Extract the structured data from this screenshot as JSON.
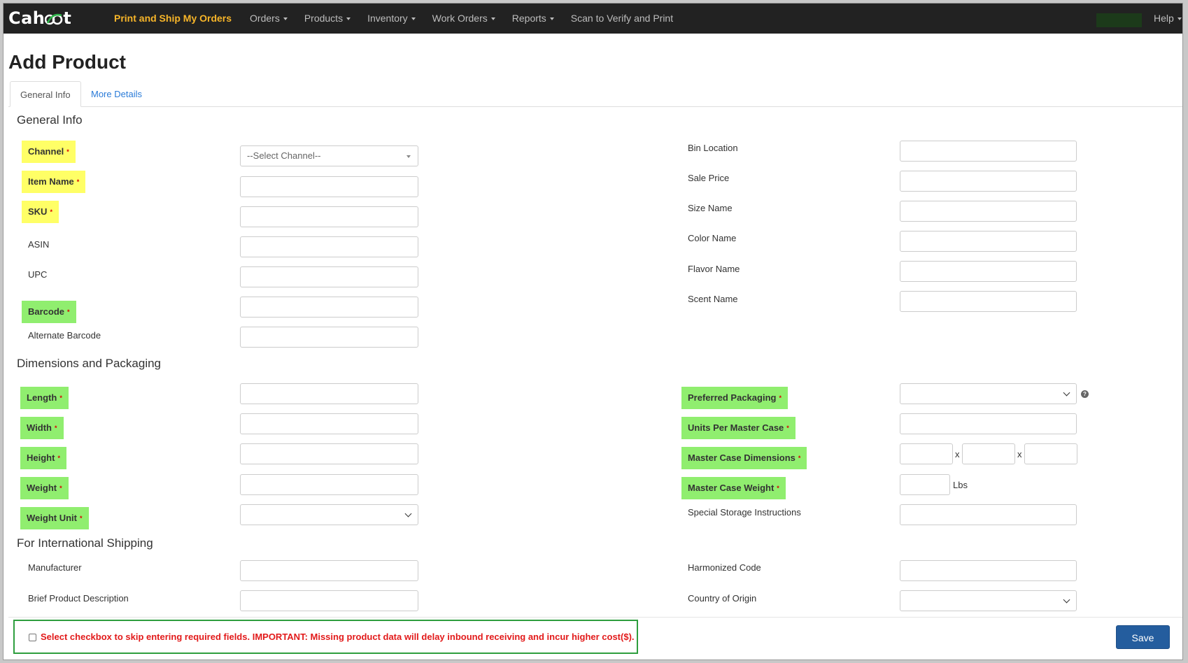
{
  "nav": {
    "logo": "Cahoot",
    "brand": "Print and Ship My Orders",
    "items": [
      {
        "label": "Orders",
        "dropdown": true
      },
      {
        "label": "Products",
        "dropdown": true
      },
      {
        "label": "Inventory",
        "dropdown": true
      },
      {
        "label": "Work Orders",
        "dropdown": true
      },
      {
        "label": "Reports",
        "dropdown": true
      },
      {
        "label": "Scan to Verify and Print",
        "dropdown": false
      }
    ],
    "help": "Help"
  },
  "page_title": "Add Product",
  "tabs": [
    {
      "label": "General Info",
      "active": true
    },
    {
      "label": "More Details",
      "active": false
    }
  ],
  "sections": {
    "general": "General Info",
    "dimensions": "Dimensions and Packaging",
    "international": "For International Shipping"
  },
  "general_left": [
    {
      "label": "Channel",
      "required": true,
      "highlight": "yellow",
      "type": "select",
      "placeholder": "--Select Channel--"
    },
    {
      "label": "Item Name",
      "required": true,
      "highlight": "yellow",
      "type": "text"
    },
    {
      "label": "SKU",
      "required": true,
      "highlight": "yellow",
      "type": "text"
    },
    {
      "label": "ASIN",
      "required": false,
      "highlight": "none",
      "type": "text"
    },
    {
      "label": "UPC",
      "required": false,
      "highlight": "none",
      "type": "text"
    },
    {
      "label": "Barcode",
      "required": true,
      "highlight": "green",
      "type": "text"
    },
    {
      "label": "Alternate Barcode",
      "required": false,
      "highlight": "none",
      "type": "text"
    }
  ],
  "general_right": [
    {
      "label": "Bin Location"
    },
    {
      "label": "Sale Price"
    },
    {
      "label": "Size Name"
    },
    {
      "label": "Color Name"
    },
    {
      "label": "Flavor Name"
    },
    {
      "label": "Scent Name"
    }
  ],
  "dimensions_left": [
    {
      "label": "Length",
      "required": true,
      "type": "text"
    },
    {
      "label": "Width",
      "required": true,
      "type": "text"
    },
    {
      "label": "Height",
      "required": true,
      "type": "text"
    },
    {
      "label": "Weight",
      "required": true,
      "type": "text"
    },
    {
      "label": "Weight Unit",
      "required": true,
      "type": "select"
    }
  ],
  "dimensions_right": [
    {
      "label": "Preferred Packaging",
      "required": true,
      "type": "select"
    },
    {
      "label": "Units Per Master Case",
      "required": true,
      "type": "text"
    },
    {
      "label": "Master Case Dimensions",
      "required": true,
      "type": "dims",
      "separator": "x"
    },
    {
      "label": "Master Case Weight",
      "required": true,
      "type": "weight",
      "unit": "Lbs"
    },
    {
      "label": "Special Storage Instructions",
      "required": false,
      "type": "text"
    }
  ],
  "international_left": [
    {
      "label": "Manufacturer"
    },
    {
      "label": "Brief Product Description"
    }
  ],
  "international_right": [
    {
      "label": "Harmonized Code",
      "type": "text"
    },
    {
      "label": "Country of Origin",
      "type": "select"
    }
  ],
  "footer": {
    "skip_message": "Select checkbox to skip entering required fields. IMPORTANT: Missing product data will delay inbound receiving and incur higher cost($).",
    "save_label": "Save"
  },
  "colors": {
    "navbar": "#222222",
    "brand": "#f7b529",
    "yellow_highlight": "#ffff66",
    "green_highlight": "#90ee6f",
    "warning_text": "#e21a1a",
    "warning_border": "#2e9e3e",
    "save_button": "#245d9e",
    "tab_link": "#2a7bd8"
  }
}
